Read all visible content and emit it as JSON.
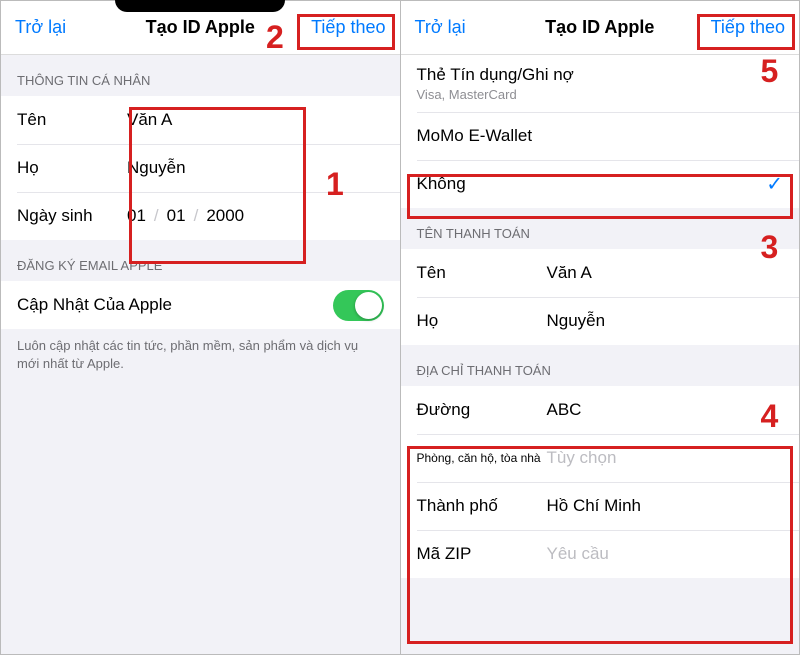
{
  "left": {
    "nav": {
      "back": "Trở lại",
      "title": "Tạo ID Apple",
      "next": "Tiếp theo"
    },
    "section_personal": "THÔNG TIN CÁ NHÂN",
    "fields": {
      "firstName": {
        "label": "Tên",
        "value": "Văn A"
      },
      "lastName": {
        "label": "Họ",
        "value": "Nguyễn"
      },
      "birthday": {
        "label": "Ngày sinh",
        "day": "01",
        "month": "01",
        "year": "2000"
      }
    },
    "section_email": "ĐĂNG KÝ EMAIL APPLE",
    "updates": {
      "label": "Cập Nhật Của Apple",
      "on": true
    },
    "footer": "Luôn cập nhật các tin tức, phần mềm, sản phẩm và dịch vụ mới nhất từ Apple."
  },
  "right": {
    "nav": {
      "back": "Trở lại",
      "title": "Tạo ID Apple",
      "next": "Tiếp theo"
    },
    "payment_methods": [
      {
        "title": "Thẻ Tín dụng/Ghi nợ",
        "sub": "Visa, MasterCard",
        "selected": false
      },
      {
        "title": "MoMo E-Wallet",
        "selected": false
      },
      {
        "title": "Không",
        "selected": true
      }
    ],
    "section_billing_name": "TÊN THANH TOÁN",
    "billing_name": {
      "firstName": {
        "label": "Tên",
        "value": "Văn A"
      },
      "lastName": {
        "label": "Họ",
        "value": "Nguyễn"
      }
    },
    "section_billing_addr": "ĐỊA CHỈ THANH TOÁN",
    "billing_addr": {
      "street": {
        "label": "Đường",
        "value": "ABC"
      },
      "apt": {
        "label": "Phòng, căn hộ, tòa nhà",
        "placeholder": "Tùy chọn"
      },
      "city": {
        "label": "Thành phố",
        "value": "Hồ Chí Minh"
      },
      "zip": {
        "label": "Mã ZIP",
        "placeholder": "Yêu cầu"
      }
    }
  },
  "annotations": {
    "1": "1",
    "2": "2",
    "3": "3",
    "4": "4",
    "5": "5"
  }
}
